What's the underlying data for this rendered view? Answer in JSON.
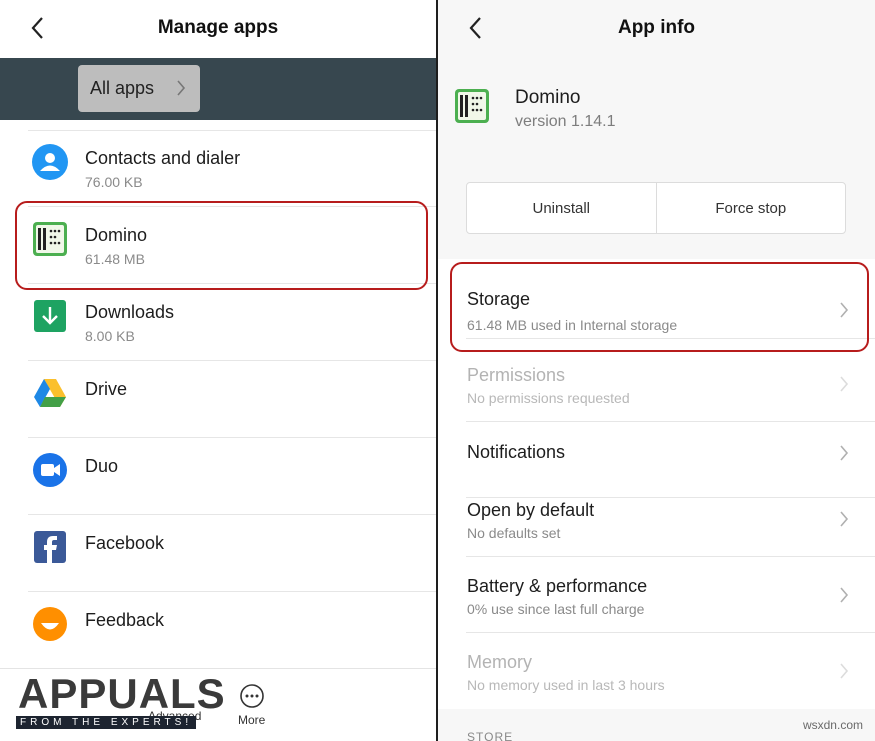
{
  "left": {
    "title": "Manage apps",
    "filter_label": "All apps",
    "apps": [
      {
        "name": "Contacts and dialer",
        "size": "76.00 KB",
        "icon": "contacts-icon"
      },
      {
        "name": "Domino",
        "size": "61.48 MB",
        "icon": "domino-icon"
      },
      {
        "name": "Downloads",
        "size": "8.00 KB",
        "icon": "downloads-icon"
      },
      {
        "name": "Drive",
        "size": "",
        "icon": "drive-icon"
      },
      {
        "name": "Duo",
        "size": "",
        "icon": "duo-icon"
      },
      {
        "name": "Facebook",
        "size": "",
        "icon": "facebook-icon"
      },
      {
        "name": "Feedback",
        "size": "",
        "icon": "feedback-icon"
      }
    ],
    "bottom": {
      "advanced_label": "Advanced",
      "more_label": "More"
    },
    "watermark": {
      "main": "APPUALS",
      "sub": "FROM THE EXPERTS!"
    }
  },
  "right": {
    "title": "App info",
    "app_name": "Domino",
    "app_version": "version 1.14.1",
    "buttons": {
      "uninstall": "Uninstall",
      "force_stop": "Force stop"
    },
    "settings": [
      {
        "title": "Storage",
        "subtitle": "61.48 MB used in Internal storage",
        "enabled": true
      },
      {
        "title": "Permissions",
        "subtitle": "No permissions requested",
        "enabled": false
      },
      {
        "title": "Notifications",
        "subtitle": "",
        "enabled": true
      },
      {
        "title": "Open by default",
        "subtitle": "No defaults set",
        "enabled": true
      },
      {
        "title": "Battery & performance",
        "subtitle": "0% use since last full charge",
        "enabled": true
      },
      {
        "title": "Memory",
        "subtitle": "No memory used in last 3 hours",
        "enabled": false
      }
    ],
    "section_label": "STORE",
    "site_mark": "wsxdn.com"
  },
  "colors": {
    "accent_highlight": "#b71c1c",
    "filter_bar": "#37474f"
  }
}
